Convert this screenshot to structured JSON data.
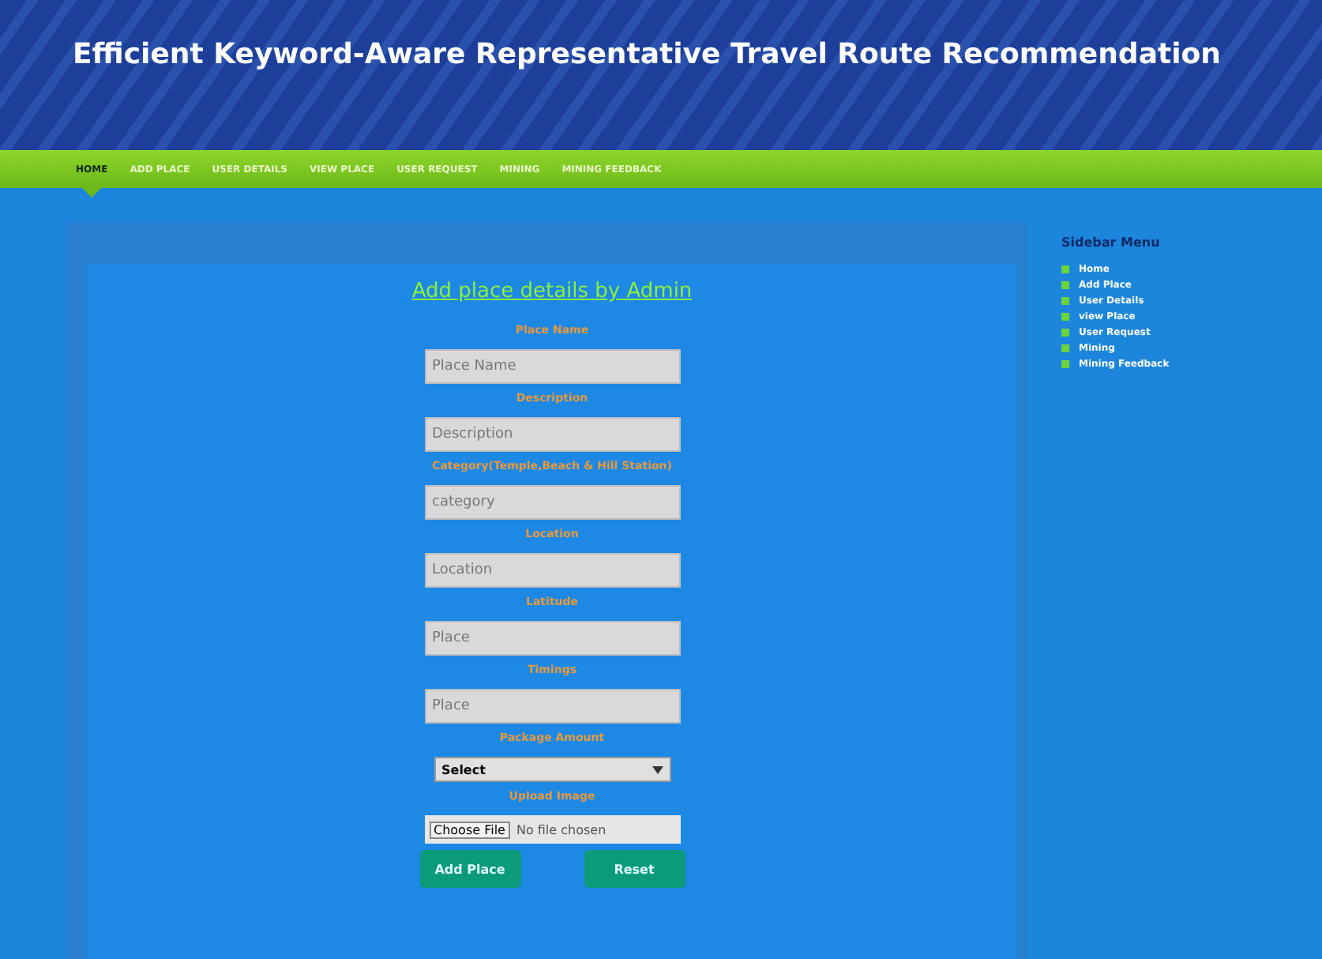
{
  "header": {
    "title": "Efficient Keyword-Aware Representative Travel Route Recommendation"
  },
  "nav": [
    {
      "label": "HOME",
      "selected": true
    },
    {
      "label": "ADD PLACE",
      "selected": false
    },
    {
      "label": "USER DETAILS",
      "selected": false
    },
    {
      "label": "VIEW PLACE",
      "selected": false
    },
    {
      "label": "USER REQUEST",
      "selected": false
    },
    {
      "label": "MINING",
      "selected": false
    },
    {
      "label": "MINING FEEDBACK",
      "selected": false
    }
  ],
  "form": {
    "heading": "Add place details by Admin",
    "fields": [
      {
        "kind": "text",
        "label": "Place Name",
        "placeholder": "Place Name"
      },
      {
        "kind": "text",
        "label": "Description",
        "placeholder": "Description"
      },
      {
        "kind": "text",
        "label": "Category(Temple,Beach & Hill Station)",
        "placeholder": "category"
      },
      {
        "kind": "text",
        "label": "Location",
        "placeholder": "Location"
      },
      {
        "kind": "text",
        "label": "Latitude",
        "placeholder": "Place"
      },
      {
        "kind": "text",
        "label": "Timings",
        "placeholder": "Place"
      },
      {
        "kind": "select",
        "label": "Package Amount",
        "value": "Select"
      },
      {
        "kind": "file",
        "label": "Upload Image",
        "button": "Choose File",
        "value": "No file chosen"
      }
    ],
    "buttons": [
      "Add Place",
      "Reset"
    ]
  },
  "sidebar": {
    "title": "Sidebar Menu",
    "items": [
      "Home",
      "Add Place",
      "User Details",
      "view Place",
      "User Request",
      "Mining",
      "Mining Feedback"
    ]
  }
}
